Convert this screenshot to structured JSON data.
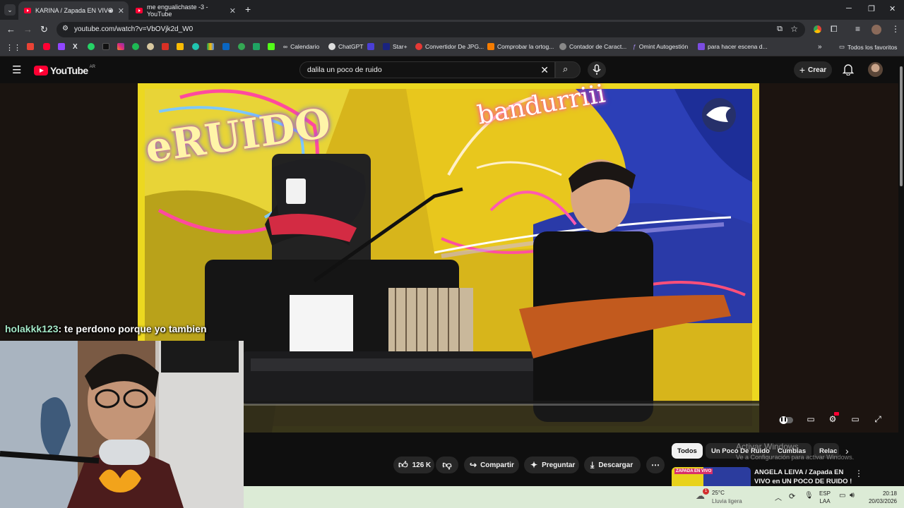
{
  "browser": {
    "tabs": [
      {
        "title": "KARINA / Zapada EN VIVO"
      },
      {
        "title": "me engualichaste -3 - YouTube"
      }
    ],
    "url": "youtube.com/watch?v=VbOVjk2d_W0",
    "bookmarks": [
      {
        "label": "Calendario"
      },
      {
        "label": "ChatGPT"
      },
      {
        "label": "Star+"
      },
      {
        "label": "Convertidor De JPG..."
      },
      {
        "label": "Comprobar la ortog..."
      },
      {
        "label": "Contador de Caract..."
      },
      {
        "label": "Omint Autogestión"
      },
      {
        "label": "para hacer escena d..."
      }
    ],
    "all_favorites": "Todos los favoritos"
  },
  "youtube": {
    "logo": "YouTube",
    "region": "AR",
    "search_value": "dalila un poco de ruido",
    "create_label": "Crear"
  },
  "video": {
    "neon_left": "eRUIDO",
    "neon_right": "bandurriii"
  },
  "stream_overlay": {
    "chat_user": "holakkk123",
    "chat_text": ": te perdono porque yo tambien"
  },
  "actions": {
    "likes": "126 K",
    "share": "Compartir",
    "ask": "Preguntar",
    "download": "Descargar"
  },
  "chips": [
    "Todos",
    "Un Poco De Ruido",
    "Cumbias",
    "Relac"
  ],
  "recommendation": {
    "title_line1": "ANGELA LEIVA / Zapada EN",
    "title_line2": "VIVO en UN POCO DE RUIDO !",
    "thumb_text": "ZAPADA EN VIVO"
  },
  "watermark": {
    "line1": "Activar Windows",
    "line2": "Ve a Configuración para activar Windows."
  },
  "taskbar": {
    "temp": "25°C",
    "weather": "Lluvia ligera",
    "notif": "1",
    "lang1": "ESP",
    "lang2": "LAA",
    "time": "20:18",
    "date": "20/03/2026"
  },
  "colors": {
    "youtube_red": "#ff0033",
    "chat_user": "#a3e7c6"
  }
}
